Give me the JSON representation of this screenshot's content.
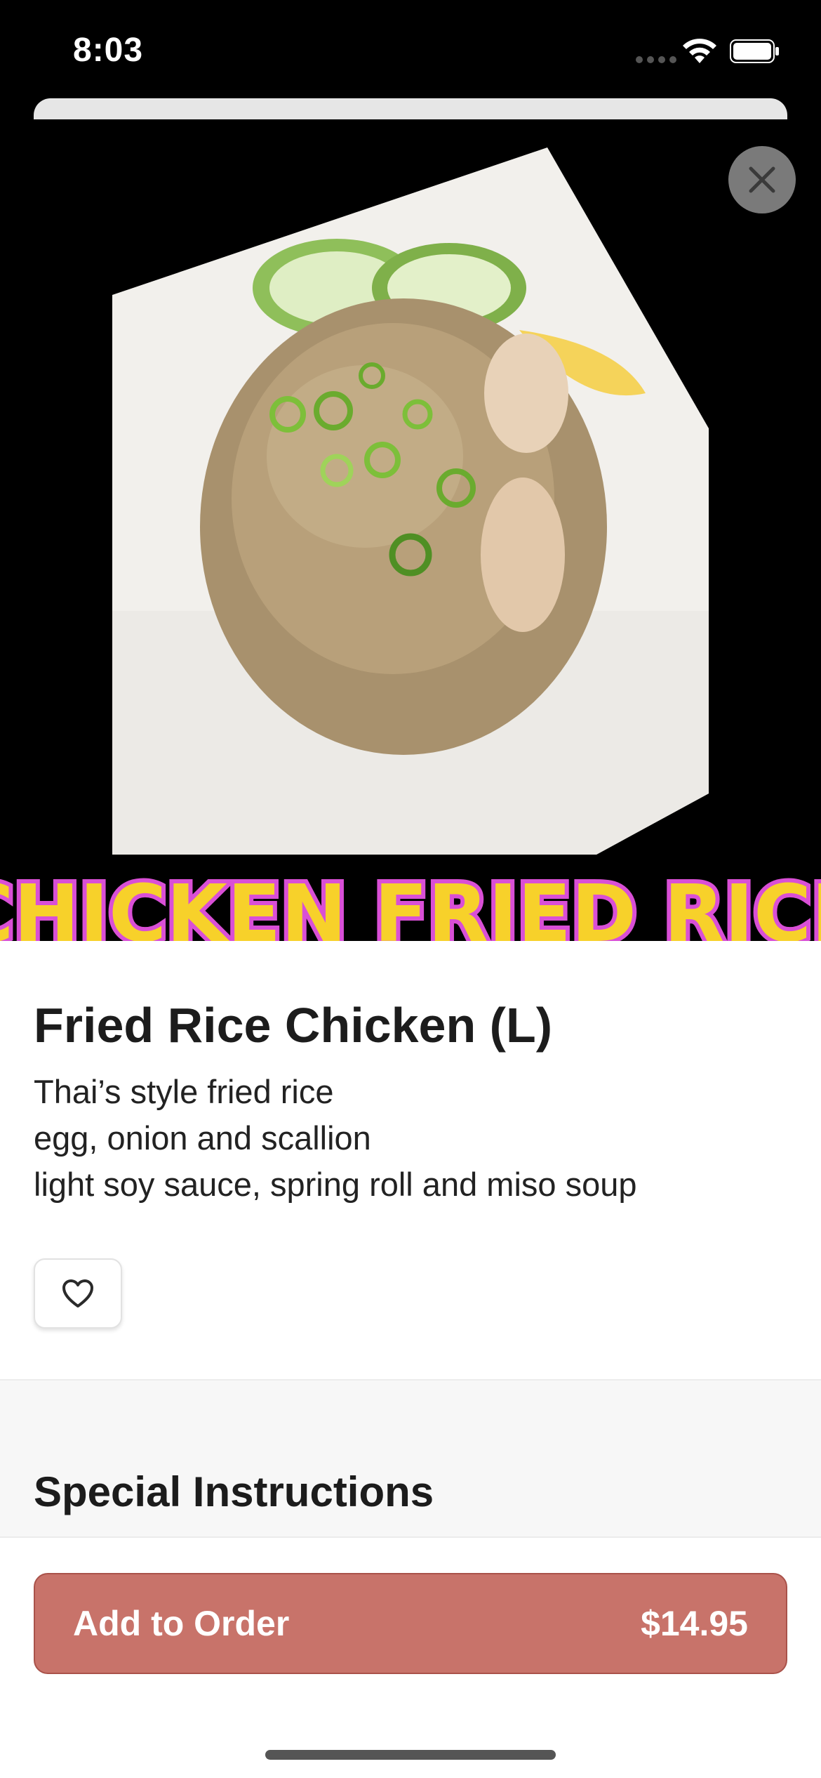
{
  "status_bar": {
    "time": "8:03"
  },
  "hero": {
    "banner_text": "CHICKEN FRIED RICE"
  },
  "item": {
    "title": "Fried Rice Chicken (L)",
    "description": [
      "Thai’s style fried rice",
      "egg, onion and scallion",
      "light soy sauce, spring roll and miso soup"
    ]
  },
  "special_instructions": {
    "title": "Special Instructions"
  },
  "footer": {
    "add_label": "Add to Order",
    "price": "$14.95"
  },
  "colors": {
    "accent": "#c8736a",
    "accent_border": "#a9524a",
    "banner_fill": "#f7d12a",
    "banner_outline": "#d94fd6"
  },
  "icons": [
    "close-icon",
    "heart-icon",
    "wifi-icon",
    "battery-icon"
  ]
}
